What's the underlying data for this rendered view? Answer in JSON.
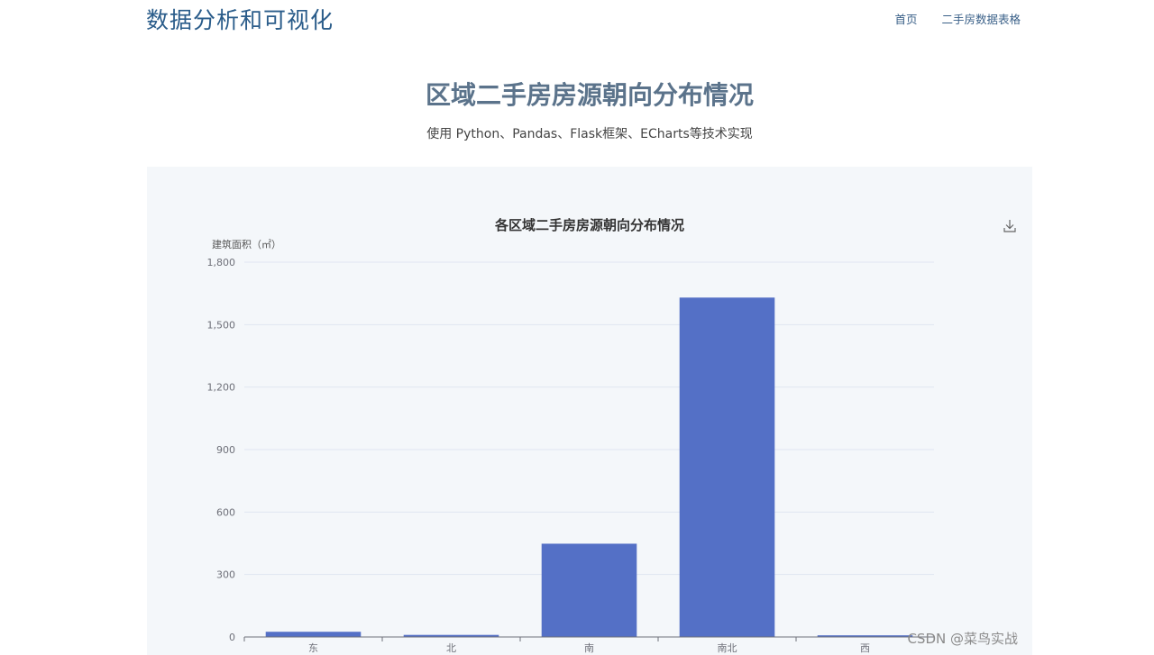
{
  "nav": {
    "brand": "数据分析和可视化",
    "links": [
      "首页",
      "二手房数据表格"
    ]
  },
  "header": {
    "title": "区域二手房房源朝向分布情况",
    "subtitle": "使用 Python、Pandas、Flask框架、ECharts等技术实现"
  },
  "toolbox": {
    "icon": "download-icon"
  },
  "watermark": "CSDN @菜鸟实战",
  "colors": {
    "bar": "#5470c6",
    "panel_bg": "#f4f7fa",
    "title": "#5b738b",
    "brand": "#2a5c8a"
  },
  "chart_data": {
    "type": "bar",
    "title": "各区域二手房房源朝向分布情况",
    "ylabel": "建筑面积（㎡）",
    "xlabel": "",
    "categories": [
      "东",
      "北",
      "南",
      "南北",
      "西"
    ],
    "values": [
      25,
      10,
      448,
      1630,
      8
    ],
    "ylim": [
      0,
      1800
    ],
    "yticks": [
      0,
      300,
      600,
      900,
      1200,
      1500,
      1800
    ],
    "ytick_labels": [
      "0",
      "300",
      "600",
      "900",
      "1,200",
      "1,500",
      "1,800"
    ],
    "grid": true,
    "legend": "none"
  }
}
